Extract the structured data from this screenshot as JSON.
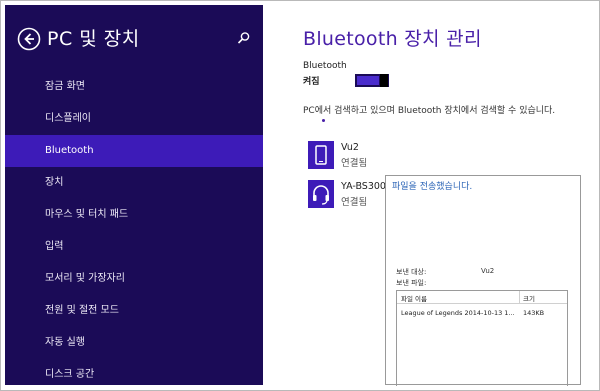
{
  "sidebar": {
    "title": "PC 및 장치",
    "items": [
      {
        "label": "잠금 화면"
      },
      {
        "label": "디스플레이"
      },
      {
        "label": "Bluetooth",
        "active": true
      },
      {
        "label": "장치"
      },
      {
        "label": "마우스 및 터치 패드"
      },
      {
        "label": "입력"
      },
      {
        "label": "모서리 및 가장자리"
      },
      {
        "label": "전원 및 절전 모드"
      },
      {
        "label": "자동 실행"
      },
      {
        "label": "디스크 공간"
      }
    ]
  },
  "main": {
    "title": "Bluetooth 장치 관리",
    "bluetooth_label": "Bluetooth",
    "toggle_state": "켜짐",
    "search_message": "PC에서 검색하고 있으며 Bluetooth 장치에서 검색할 수 있습니다.",
    "devices": [
      {
        "name": "Vu2",
        "status": "연결됨",
        "icon": "phone-icon"
      },
      {
        "name": "YA-BS300",
        "status": "연결됨",
        "icon": "headset-icon"
      }
    ]
  },
  "transfer": {
    "title": "파일을 전송했습니다.",
    "recipient_label": "보낸 대상:",
    "recipient_value": "Vu2",
    "files_label": "보낸 파일:",
    "col_name": "파일 이름",
    "col_size": "크기",
    "file_name": "League of Legends 2014-10-13 1...",
    "file_size": "143KB"
  },
  "colors": {
    "sidebar_bg": "#1b0b57",
    "active_item": "#3d1bb8",
    "accent": "#4920a8",
    "link": "#2b64b6"
  }
}
